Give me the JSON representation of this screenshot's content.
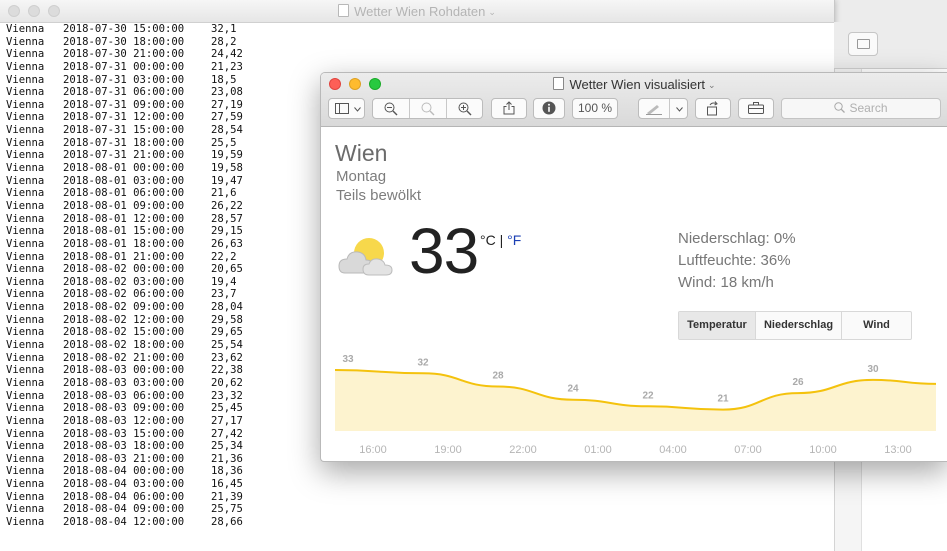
{
  "raw_window": {
    "title": "Wetter Wien Rohdaten",
    "rows": [
      {
        "city": "Vienna",
        "date": "2018-07-30",
        "time": "15:00:00",
        "value": "32,1"
      },
      {
        "city": "Vienna",
        "date": "2018-07-30",
        "time": "18:00:00",
        "value": "28,2"
      },
      {
        "city": "Vienna",
        "date": "2018-07-30",
        "time": "21:00:00",
        "value": "24,42"
      },
      {
        "city": "Vienna",
        "date": "2018-07-31",
        "time": "00:00:00",
        "value": "21,23"
      },
      {
        "city": "Vienna",
        "date": "2018-07-31",
        "time": "03:00:00",
        "value": "18,5"
      },
      {
        "city": "Vienna",
        "date": "2018-07-31",
        "time": "06:00:00",
        "value": "23,08"
      },
      {
        "city": "Vienna",
        "date": "2018-07-31",
        "time": "09:00:00",
        "value": "27,19"
      },
      {
        "city": "Vienna",
        "date": "2018-07-31",
        "time": "12:00:00",
        "value": "27,59"
      },
      {
        "city": "Vienna",
        "date": "2018-07-31",
        "time": "15:00:00",
        "value": "28,54"
      },
      {
        "city": "Vienna",
        "date": "2018-07-31",
        "time": "18:00:00",
        "value": "25,5"
      },
      {
        "city": "Vienna",
        "date": "2018-07-31",
        "time": "21:00:00",
        "value": "19,59"
      },
      {
        "city": "Vienna",
        "date": "2018-08-01",
        "time": "00:00:00",
        "value": "19,58"
      },
      {
        "city": "Vienna",
        "date": "2018-08-01",
        "time": "03:00:00",
        "value": "19,47"
      },
      {
        "city": "Vienna",
        "date": "2018-08-01",
        "time": "06:00:00",
        "value": "21,6"
      },
      {
        "city": "Vienna",
        "date": "2018-08-01",
        "time": "09:00:00",
        "value": "26,22"
      },
      {
        "city": "Vienna",
        "date": "2018-08-01",
        "time": "12:00:00",
        "value": "28,57"
      },
      {
        "city": "Vienna",
        "date": "2018-08-01",
        "time": "15:00:00",
        "value": "29,15"
      },
      {
        "city": "Vienna",
        "date": "2018-08-01",
        "time": "18:00:00",
        "value": "26,63"
      },
      {
        "city": "Vienna",
        "date": "2018-08-01",
        "time": "21:00:00",
        "value": "22,2"
      },
      {
        "city": "Vienna",
        "date": "2018-08-02",
        "time": "00:00:00",
        "value": "20,65"
      },
      {
        "city": "Vienna",
        "date": "2018-08-02",
        "time": "03:00:00",
        "value": "19,4"
      },
      {
        "city": "Vienna",
        "date": "2018-08-02",
        "time": "06:00:00",
        "value": "23,7"
      },
      {
        "city": "Vienna",
        "date": "2018-08-02",
        "time": "09:00:00",
        "value": "28,04"
      },
      {
        "city": "Vienna",
        "date": "2018-08-02",
        "time": "12:00:00",
        "value": "29,58"
      },
      {
        "city": "Vienna",
        "date": "2018-08-02",
        "time": "15:00:00",
        "value": "29,65"
      },
      {
        "city": "Vienna",
        "date": "2018-08-02",
        "time": "18:00:00",
        "value": "25,54"
      },
      {
        "city": "Vienna",
        "date": "2018-08-02",
        "time": "21:00:00",
        "value": "23,62"
      },
      {
        "city": "Vienna",
        "date": "2018-08-03",
        "time": "00:00:00",
        "value": "22,38"
      },
      {
        "city": "Vienna",
        "date": "2018-08-03",
        "time": "03:00:00",
        "value": "20,62"
      },
      {
        "city": "Vienna",
        "date": "2018-08-03",
        "time": "06:00:00",
        "value": "23,32"
      },
      {
        "city": "Vienna",
        "date": "2018-08-03",
        "time": "09:00:00",
        "value": "25,45"
      },
      {
        "city": "Vienna",
        "date": "2018-08-03",
        "time": "12:00:00",
        "value": "27,17"
      },
      {
        "city": "Vienna",
        "date": "2018-08-03",
        "time": "15:00:00",
        "value": "27,42"
      },
      {
        "city": "Vienna",
        "date": "2018-08-03",
        "time": "18:00:00",
        "value": "25,34"
      },
      {
        "city": "Vienna",
        "date": "2018-08-03",
        "time": "21:00:00",
        "value": "21,36"
      },
      {
        "city": "Vienna",
        "date": "2018-08-04",
        "time": "00:00:00",
        "value": "18,36"
      },
      {
        "city": "Vienna",
        "date": "2018-08-04",
        "time": "03:00:00",
        "value": "16,45"
      },
      {
        "city": "Vienna",
        "date": "2018-08-04",
        "time": "06:00:00",
        "value": "21,39"
      },
      {
        "city": "Vienna",
        "date": "2018-08-04",
        "time": "09:00:00",
        "value": "25,75"
      },
      {
        "city": "Vienna",
        "date": "2018-08-04",
        "time": "12:00:00",
        "value": "28,66"
      }
    ]
  },
  "viz_window": {
    "title": "Wetter Wien visualisiert",
    "toolbar": {
      "zoom_level": "100 %",
      "search_placeholder": "Search",
      "icons": [
        "sidebar-icon",
        "chevron-down-icon",
        "zoom-out-icon",
        "zoom-fit-icon",
        "zoom-in-icon",
        "share-icon",
        "info-icon",
        "markup-pen-icon",
        "chevron-down-icon",
        "rotate-icon",
        "toolbox-icon",
        "search-icon"
      ]
    },
    "weather": {
      "city": "Wien",
      "day": "Montag",
      "condition": "Teils bewölkt",
      "condition_icon": "partly-cloudy-icon",
      "temperature": "33",
      "unit_c": "°C",
      "unit_sep": " | ",
      "unit_f": "°F",
      "precipitation": "Niederschlag: 0%",
      "humidity": "Luftfeuchte: 36%",
      "wind": "Wind: 18 km/h",
      "tabs": [
        "Temperatur",
        "Niederschlag",
        "Wind"
      ],
      "active_tab": "Temperatur"
    },
    "colors": {
      "line": "#f4c20d",
      "fill": "#fdf3cf",
      "accent_f": "#1b3fb3"
    }
  },
  "chart_data": {
    "type": "area",
    "x": [
      "16:00",
      "19:00",
      "22:00",
      "01:00",
      "04:00",
      "07:00",
      "10:00",
      "13:00"
    ],
    "values": [
      33,
      32,
      28,
      24,
      22,
      21,
      26,
      30
    ],
    "data_labels": [
      "33",
      "32",
      "28",
      "24",
      "22",
      "21",
      "26",
      "30"
    ],
    "title": "",
    "xlabel": "",
    "ylabel": ""
  }
}
